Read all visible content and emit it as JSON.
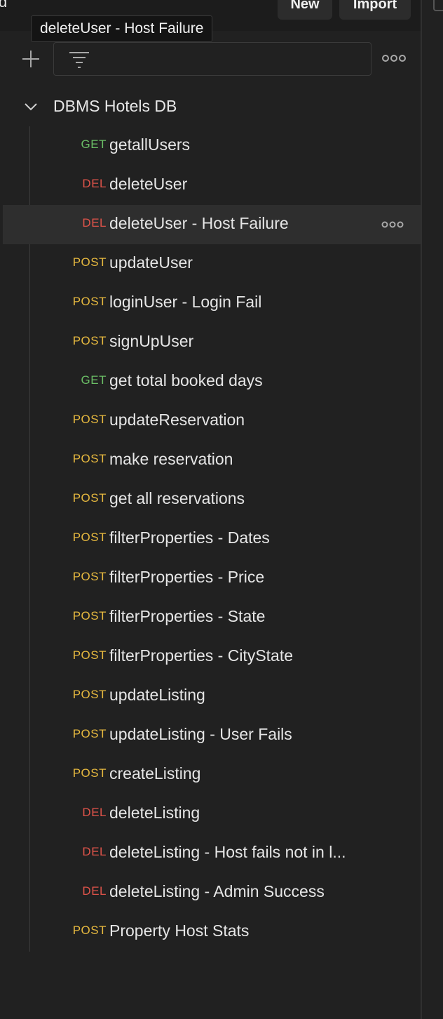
{
  "header": {
    "left_text": "d",
    "new_label": "New",
    "import_label": "Import"
  },
  "tooltip": "deleteUser - Host Failure",
  "toolbar": {
    "add_icon": "plus-icon",
    "filter_icon": "filter-icon",
    "filter_placeholder": "",
    "more_icon": "more-horizontal-icon"
  },
  "collection": {
    "name": "DBMS Hotels DB",
    "expanded": true
  },
  "requests": [
    {
      "method": "GET",
      "name": "getallUsers"
    },
    {
      "method": "DEL",
      "name": "deleteUser"
    },
    {
      "method": "DEL",
      "name": "deleteUser - Host Failure",
      "selected": true
    },
    {
      "method": "POST",
      "name": "updateUser"
    },
    {
      "method": "POST",
      "name": "loginUser - Login Fail"
    },
    {
      "method": "POST",
      "name": "signUpUser"
    },
    {
      "method": "GET",
      "name": "get total booked days"
    },
    {
      "method": "POST",
      "name": "updateReservation"
    },
    {
      "method": "POST",
      "name": "make reservation"
    },
    {
      "method": "POST",
      "name": "get all reservations"
    },
    {
      "method": "POST",
      "name": "filterProperties - Dates"
    },
    {
      "method": "POST",
      "name": "filterProperties - Price"
    },
    {
      "method": "POST",
      "name": "filterProperties - State"
    },
    {
      "method": "POST",
      "name": "filterProperties - CityState"
    },
    {
      "method": "POST",
      "name": "updateListing"
    },
    {
      "method": "POST",
      "name": "updateListing - User Fails"
    },
    {
      "method": "POST",
      "name": "createListing"
    },
    {
      "method": "DEL",
      "name": "deleteListing"
    },
    {
      "method": "DEL",
      "name": "deleteListing - Host fails not in l..."
    },
    {
      "method": "DEL",
      "name": "deleteListing - Admin Success"
    },
    {
      "method": "POST",
      "name": "Property Host Stats"
    }
  ],
  "colors": {
    "get": "#6bbf66",
    "del": "#e0544a",
    "post": "#e7b93f",
    "background": "#212121",
    "selected_row": "#2e2e2e"
  }
}
